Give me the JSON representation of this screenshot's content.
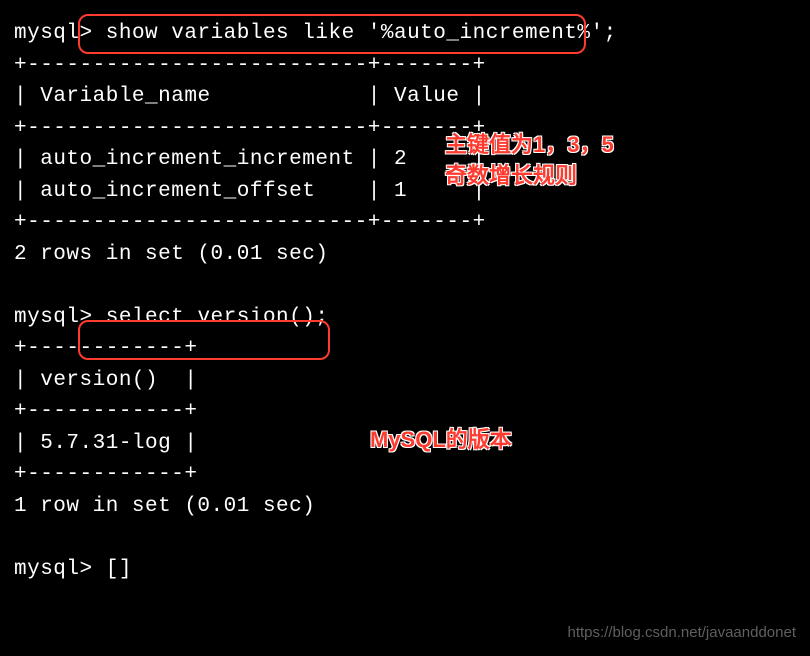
{
  "terminal": {
    "prompt": "mysql>",
    "query1": "show variables like '%auto_increment%';",
    "table1_header_col1": "Variable_name",
    "table1_header_col2": "Value",
    "table1_row1_col1": "auto_increment_increment",
    "table1_row1_col2": "2",
    "table1_row2_col1": "auto_increment_offset",
    "table1_row2_col2": "1",
    "result1": "2 rows in set (0.01 sec)",
    "query2": "select version();",
    "table2_header": "version()",
    "table2_row1": "5.7.31-log",
    "result2": "1 row in set (0.01 sec)",
    "cursor": "[]",
    "border1": "+--------------------------+-------+",
    "border2": "+------------+"
  },
  "annotations": {
    "anno1_line1": "主键值为1，3，5",
    "anno1_line2": "奇数增长规则",
    "anno2": "MySQL的版本"
  },
  "watermark": "https://blog.csdn.net/javaanddonet"
}
